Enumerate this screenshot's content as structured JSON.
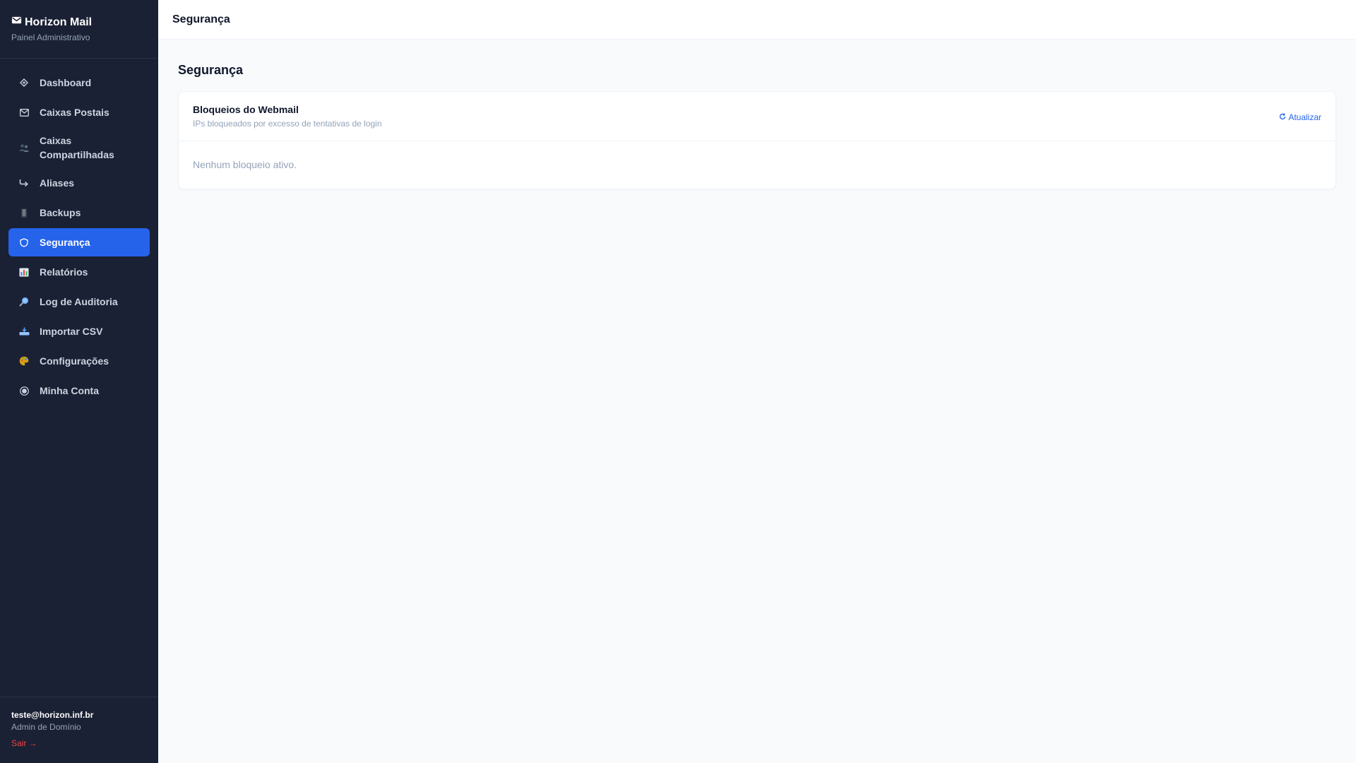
{
  "brand": {
    "title": "Horizon Mail",
    "subtitle": "Painel Administrativo"
  },
  "sidebar": {
    "items": [
      {
        "label": "Dashboard",
        "icon": "diamond-icon"
      },
      {
        "label": "Caixas Postais",
        "icon": "envelope-icon"
      },
      {
        "label": "Caixas Compartilhadas",
        "icon": "users-icon"
      },
      {
        "label": "Aliases",
        "icon": "forward-arrow-icon"
      },
      {
        "label": "Backups",
        "icon": "storage-icon"
      },
      {
        "label": "Segurança",
        "icon": "shield-icon",
        "active": true
      },
      {
        "label": "Relatórios",
        "icon": "bar-chart-icon"
      },
      {
        "label": "Log de Auditoria",
        "icon": "magnifier-icon"
      },
      {
        "label": "Importar CSV",
        "icon": "inbox-tray-icon"
      },
      {
        "label": "Configurações",
        "icon": "palette-icon"
      },
      {
        "label": "Minha Conta",
        "icon": "user-circle-icon"
      }
    ]
  },
  "user": {
    "email": "teste@horizon.inf.br",
    "role": "Admin de Domínio",
    "logout_label": "Sair →"
  },
  "topbar": {
    "title": "Segurança"
  },
  "main": {
    "title": "Segurança",
    "card": {
      "title": "Bloqueios do Webmail",
      "subtitle": "IPs bloqueados por excesso de tentativas de login",
      "refresh_label": "Atualizar",
      "empty_text": "Nenhum bloqueio ativo."
    }
  },
  "colors": {
    "sidebar_bg": "#1b2134",
    "accent": "#2563eb",
    "logout": "#ef4444",
    "page_bg": "#f8fafc"
  }
}
